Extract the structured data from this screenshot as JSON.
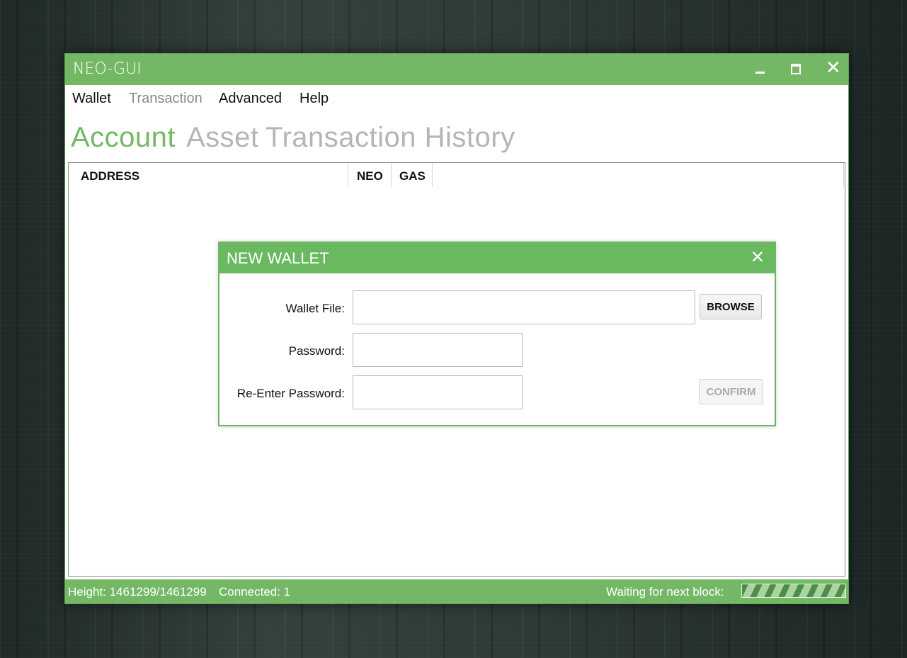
{
  "window": {
    "title": "NEO-GUI",
    "controls": {
      "minimize": "minimize-icon",
      "maximize": "maximize-icon",
      "close": "close-icon"
    }
  },
  "menu": {
    "items": [
      {
        "label": "Wallet",
        "enabled": true
      },
      {
        "label": "Transaction",
        "enabled": false
      },
      {
        "label": "Advanced",
        "enabled": true
      },
      {
        "label": "Help",
        "enabled": true
      }
    ]
  },
  "tabs": [
    {
      "label": "Account",
      "active": true
    },
    {
      "label": "Asset",
      "active": false
    },
    {
      "label": "Transaction History",
      "active": false
    }
  ],
  "grid": {
    "columns": [
      "ADDRESS",
      "NEO",
      "GAS"
    ],
    "rows": []
  },
  "dialog": {
    "title": "NEW WALLET",
    "close_icon": "close-icon",
    "fields": {
      "wallet_file": {
        "label": "Wallet File:",
        "value": ""
      },
      "password": {
        "label": "Password:",
        "value": ""
      },
      "reenter_password": {
        "label": "Re-Enter Password:",
        "value": ""
      }
    },
    "browse_label": "BROWSE",
    "confirm_label": "CONFIRM"
  },
  "status": {
    "height": "Height: 1461299/1461299",
    "connected": "Connected:  1",
    "waiting": "Waiting for next block:"
  },
  "colors": {
    "accent": "#74b866",
    "dialog_accent": "#6ab961",
    "inactive_tab": "#b5b5b5",
    "disabled_text": "#8a8a8a"
  }
}
